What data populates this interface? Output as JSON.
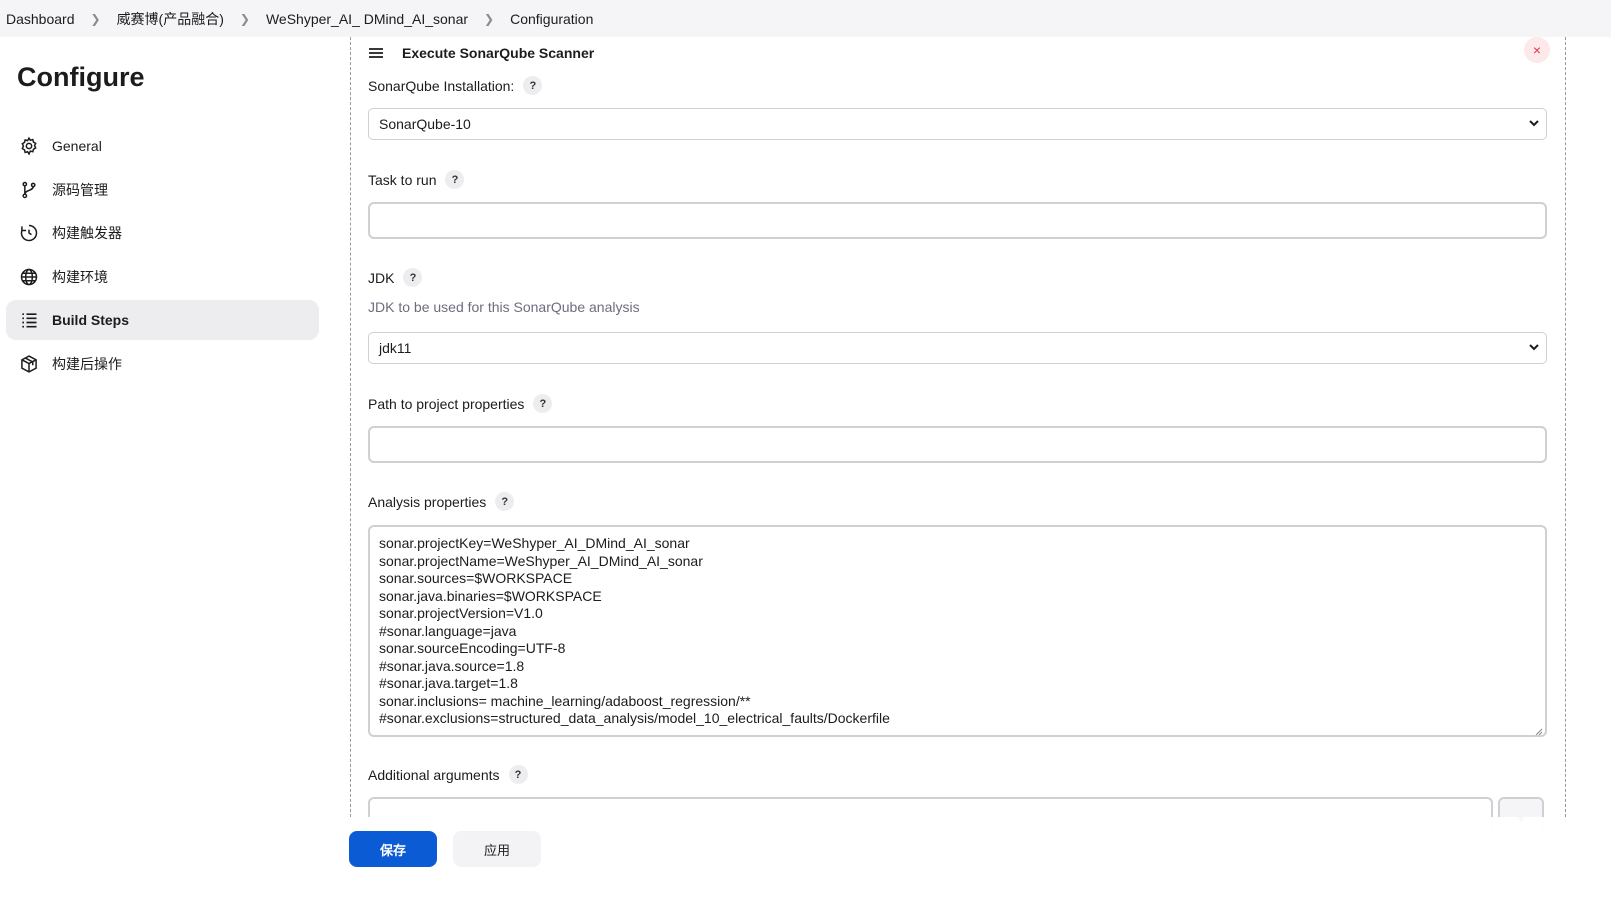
{
  "breadcrumb": [
    "Dashboard",
    "威赛博(产品融合)",
    "WeShyper_AI_ DMind_AI_sonar",
    "Configuration"
  ],
  "sidebar": {
    "title": "Configure",
    "items": [
      {
        "label": "General",
        "icon": "gear-icon"
      },
      {
        "label": "源码管理",
        "icon": "branch-icon"
      },
      {
        "label": "构建触发器",
        "icon": "clock-icon"
      },
      {
        "label": "构建环境",
        "icon": "globe-icon"
      },
      {
        "label": "Build Steps",
        "icon": "list-icon",
        "active": true
      },
      {
        "label": "构建后操作",
        "icon": "cube-icon"
      }
    ]
  },
  "step": {
    "title": "Execute SonarQube Scanner",
    "installation": {
      "label": "SonarQube Installation:",
      "value": "SonarQube-10"
    },
    "task": {
      "label": "Task to run",
      "value": ""
    },
    "jdk": {
      "label": "JDK",
      "description": "JDK to be used for this SonarQube analysis",
      "value": "jdk11"
    },
    "path": {
      "label": "Path to project properties",
      "value": ""
    },
    "analysis": {
      "label": "Analysis properties",
      "lines": [
        "sonar.projectKey=WeShyper_AI_DMind_AI_sonar",
        "sonar.projectName=WeShyper_AI_DMind_AI_sonar",
        "sonar.sources=$WORKSPACE",
        "sonar.java.binaries=$WORKSPACE",
        "sonar.projectVersion=V1.0",
        "#sonar.language=java",
        "sonar.sourceEncoding=UTF-8",
        "#sonar.java.source=1.8",
        "#sonar.java.target=1.8",
        "sonar.inclusions= machine_learning/adaboost_regression/**",
        "#sonar.exclusions=structured_data_analysis/model_10_electrical_faults/Dockerfile"
      ]
    },
    "additional": {
      "label": "Additional arguments"
    }
  },
  "help_label": "?",
  "delete_label": "×",
  "buttons": {
    "save": "保存",
    "apply": "应用"
  },
  "colors": {
    "primary": "#0b5bd4",
    "delete": "#e0364a"
  }
}
